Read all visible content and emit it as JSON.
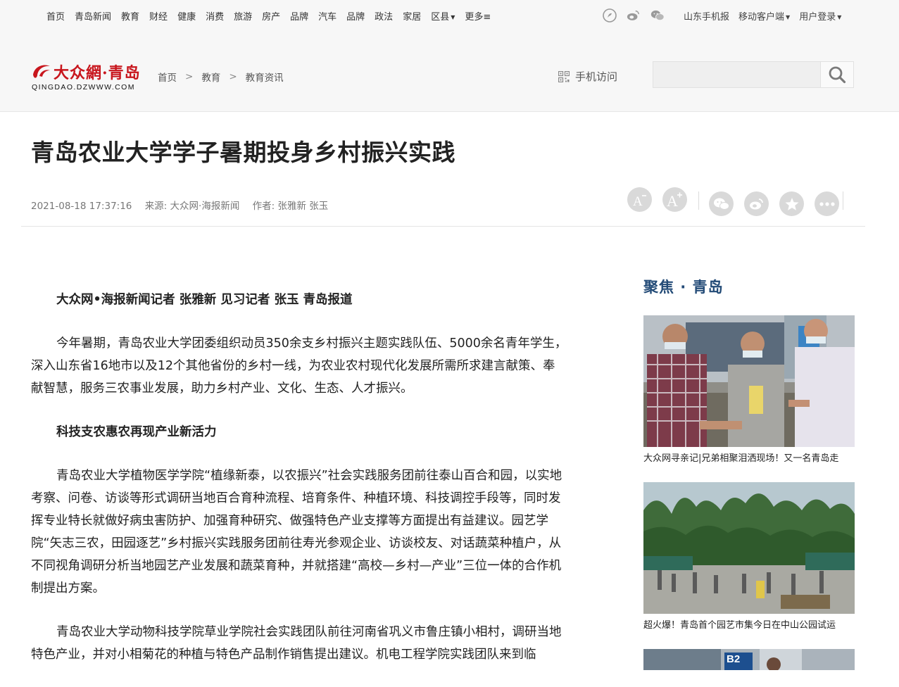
{
  "topnav": {
    "items": [
      "首页",
      "青岛新闻",
      "教育",
      "财经",
      "健康",
      "消费",
      "旅游",
      "房产",
      "品牌",
      "汽车",
      "品牌",
      "政法",
      "家居",
      "区县",
      "更多"
    ],
    "more_glyph": "≡",
    "social_icons": [
      "weibo-circle-icon",
      "weibo-icon",
      "wechat-icon"
    ],
    "right_links": [
      "山东手机报",
      "移动客户端",
      "用户登录"
    ]
  },
  "logo": {
    "text": "大众網·青岛",
    "sub": "QINGDAO.DZWWW.COM",
    "brand_color": "#c8161d"
  },
  "breadcrumb": [
    "首页",
    "教育",
    "教育资讯"
  ],
  "breadcrumb_sep": ">",
  "mobile_visit": "手机访问",
  "search": {
    "placeholder": "",
    "value": ""
  },
  "article": {
    "title": "青岛农业大学学子暑期投身乡村振兴实践",
    "date": "2021-08-18 17:37:16",
    "source": "来源: 大众网·海报新闻",
    "author": "作者: 张雅新 张玉",
    "paragraphs": [
      {
        "text": "大众网•海报新闻记者 张雅新 见习记者 张玉 青岛报道",
        "bold": true
      },
      {
        "text": "今年暑期，青岛农业大学团委组织动员350余支乡村振兴主题实践队伍、5000余名青年学生，深入山东省16地市以及12个其他省份的乡村一线，为农业农村现代化发展所需所求建言献策、奉献智慧，服务三农事业发展，助力乡村产业、文化、生态、人才振兴。",
        "bold": false
      },
      {
        "text": "科技支农惠农再现产业新活力",
        "bold": true
      },
      {
        "text": "青岛农业大学植物医学学院“植缘新泰，以农振兴”社会实践服务团前往泰山百合和园，以实地考察、问卷、访谈等形式调研当地百合育种流程、培育条件、种植环境、科技调控手段等，同时发挥专业特长就做好病虫害防护、加强育种研究、做强特色产业支撑等方面提出有益建议。园艺学院“矢志三农，田园逐艺”乡村振兴实践服务团前往寿光参观企业、访谈校友、对话蔬菜种植户，从不同视角调研分析当地园艺产业发展和蔬菜育种，并就搭建“高校—乡村—产业”三位一体的合作机制提出方案。",
        "bold": false
      },
      {
        "text": "青岛农业大学动物科技学院草业学院社会实践团队前往河南省巩义市鲁庄镇小相村，调研当地特色产业，并对小相菊花的种植与特色产品制作销售提出建议。机电工程学院实践团队来到临",
        "bold": false
      }
    ]
  },
  "tools": {
    "font_smaller": "A-",
    "font_larger": "A+",
    "share_icons": [
      "wechat-share-icon",
      "weibo-share-icon",
      "favorite-icon",
      "more-icon"
    ]
  },
  "sidebar": {
    "title": "聚焦 · 青岛",
    "items": [
      {
        "caption": "大众网寻亲记|兄弟相聚泪洒现场！又一名青岛走"
      },
      {
        "caption": "超火爆！青岛首个园艺市集今日在中山公园试运"
      },
      {
        "caption": "",
        "sign_text": "B2"
      }
    ]
  }
}
